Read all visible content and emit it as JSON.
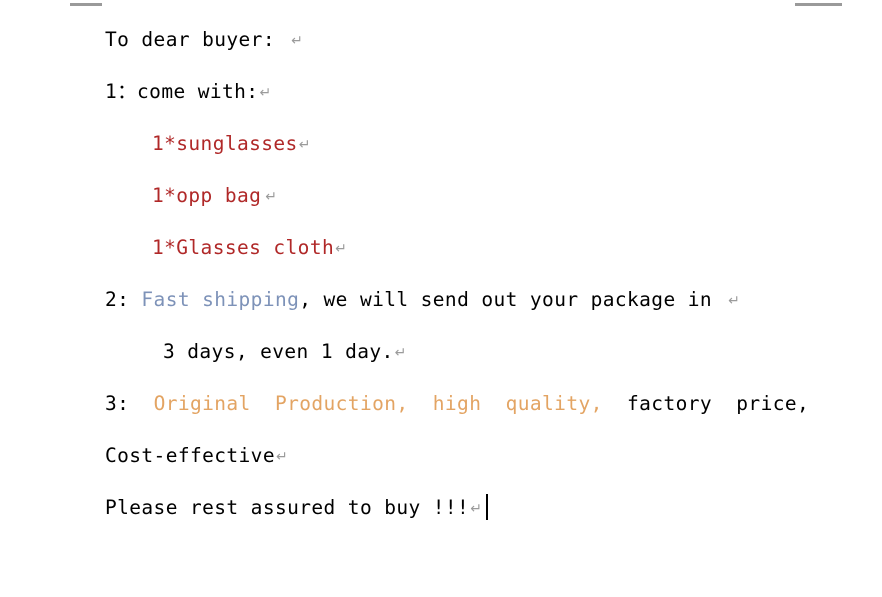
{
  "document": {
    "background_color": "#ffffff",
    "margin_markers": [
      "left-margin-marker",
      "right-margin-marker"
    ],
    "return_mark_glyph": "↵",
    "colors": {
      "body_text": "#000000",
      "red_items": "#b02828",
      "blue_highlight": "#7d92b8",
      "orange_highlight": "#e3a463",
      "return_mark": "#9b9b9b",
      "margin_marker": "#9a9a9a"
    },
    "lines": [
      {
        "id": "greeting",
        "indent": 0,
        "has_return_mark": true,
        "runs": [
          {
            "text": "To dear buyer: ",
            "color": "black"
          }
        ]
      },
      {
        "id": "item-heading",
        "indent": 0,
        "has_return_mark": true,
        "tight_mark": true,
        "runs": [
          {
            "text": "1：come with:",
            "color": "black"
          }
        ]
      },
      {
        "id": "item-sunglasses",
        "indent": 1,
        "has_return_mark": true,
        "tight_mark": true,
        "runs": [
          {
            "text": "1*sunglasses",
            "color": "red"
          }
        ]
      },
      {
        "id": "item-opp-bag",
        "indent": 1,
        "has_return_mark": true,
        "runs": [
          {
            "text": "1*opp bag",
            "color": "red"
          }
        ]
      },
      {
        "id": "item-glasses-cloth",
        "indent": 1,
        "has_return_mark": true,
        "tight_mark": true,
        "runs": [
          {
            "text": "1*Glasses cloth",
            "color": "red"
          }
        ]
      },
      {
        "id": "shipping-line-1",
        "indent": 0,
        "has_return_mark": true,
        "runs": [
          {
            "text": "2: ",
            "color": "black"
          },
          {
            "text": "Fast shipping",
            "color": "blue"
          },
          {
            "text": ", we will send out your package in ",
            "color": "black"
          }
        ]
      },
      {
        "id": "shipping-line-2",
        "indent": 2,
        "has_return_mark": true,
        "tight_mark": true,
        "runs": [
          {
            "text": "3 days, even 1 day.",
            "color": "black"
          }
        ]
      },
      {
        "id": "quality-line",
        "indent": 0,
        "has_return_mark": false,
        "runs": [
          {
            "text": "3:  ",
            "color": "black"
          },
          {
            "text": "Original  Production,  high  quality,",
            "color": "orange"
          },
          {
            "text": "  factory  price,",
            "color": "black"
          }
        ]
      },
      {
        "id": "cost-effective",
        "indent": 0,
        "has_return_mark": true,
        "tight_mark": true,
        "runs": [
          {
            "text": "Cost-effective",
            "color": "black"
          }
        ]
      },
      {
        "id": "closing",
        "indent": 0,
        "has_return_mark": true,
        "tight_mark": true,
        "has_caret": true,
        "runs": [
          {
            "text": "Please rest assured to buy !!!",
            "color": "black"
          }
        ]
      }
    ]
  }
}
